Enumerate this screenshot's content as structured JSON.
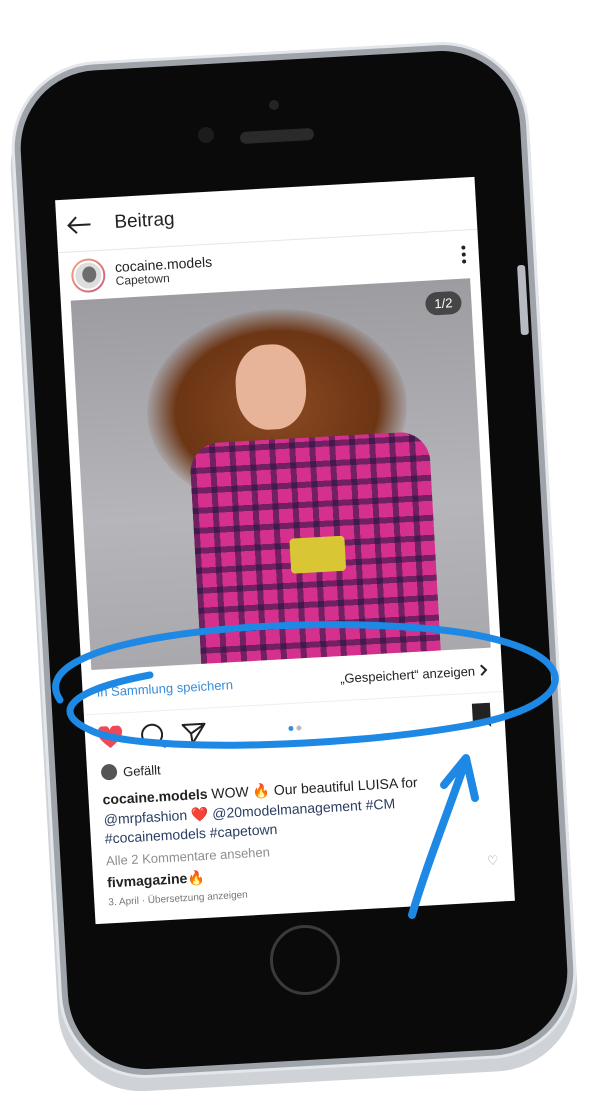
{
  "topbar": {
    "title": "Beitrag"
  },
  "post": {
    "username": "cocaine.models",
    "location": "Capetown",
    "image_counter": "1/2"
  },
  "collection": {
    "save_label": "In Sammlung speichern",
    "show_saved_label": "„Gespeichert“ anzeigen"
  },
  "likes": {
    "text": "Gefällt"
  },
  "caption": {
    "username": "cocaine.models",
    "text_1": " WOW 🔥 Our beautiful LUISA for",
    "mention_1": "@mrpfashion",
    "heart": " ❤️ ",
    "mention_2": "@20modelmanagement",
    "tag_1": " #CM",
    "tag_2": "#cocainemodels",
    "tag_3": " #capetown"
  },
  "comments_link": "Alle 2 Kommentare ansehen",
  "comment": {
    "username": "fivmagazine",
    "emoji": " 🔥"
  },
  "meta": {
    "date": "3. April",
    "separator": " · ",
    "translate": "Übersetzung anzeigen"
  },
  "colors": {
    "accent": "#3a8cd8",
    "like": "#ed4956",
    "annotation": "#1e88e5"
  },
  "icons": [
    "back-arrow-icon",
    "more-icon",
    "heart-icon",
    "comment-icon",
    "share-icon",
    "bookmark-icon",
    "chevron-right-icon"
  ]
}
